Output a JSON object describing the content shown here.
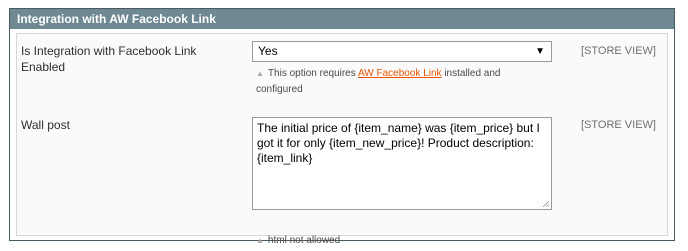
{
  "section": {
    "title": "Integration with AW Facebook Link"
  },
  "fields": {
    "integration_enabled": {
      "label": "Is Integration with Facebook Link Enabled",
      "value": "Yes",
      "note_prefix": "This option requires ",
      "note_link": "AW Facebook Link",
      "note_suffix": " installed and configured",
      "scope": "[STORE VIEW]"
    },
    "wall_post": {
      "label": "Wall post",
      "value": "The initial price of {item_name} was {item_price} but I got it for only {item_new_price}! Product description: {item_link}",
      "note": "html not allowed",
      "scope": "[STORE VIEW]"
    }
  },
  "colors": {
    "header_bg": "#6f8992",
    "link": "#eb5202"
  },
  "icons": {
    "select_arrow": "triangle-down",
    "note_marker": "triangle-up"
  }
}
